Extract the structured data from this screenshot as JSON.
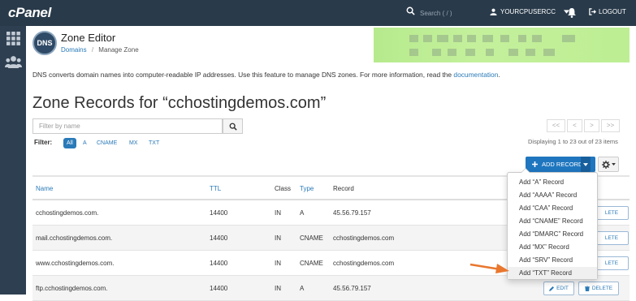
{
  "app": {
    "logo": "cPanel"
  },
  "header": {
    "search_placeholder": "Search ( / )",
    "username": "YOURCPUSERCC",
    "logout": "LOGOUT"
  },
  "page": {
    "title": "Zone Editor",
    "breadcrumb": {
      "root": "Domains",
      "separator": "/",
      "current": "Manage Zone"
    },
    "intro_text": "DNS converts domain names into computer-readable IP addresses. Use this feature to manage DNS zones. For more information, read the ",
    "intro_link": "documentation",
    "intro_end": ".",
    "badge": "DNS"
  },
  "zone": {
    "heading": "Zone Records for “cchostingdemos.com”",
    "filter_placeholder": "Filter by name",
    "filter_label": "Filter:",
    "filters": [
      "All",
      "A",
      "CNAME",
      "MX",
      "TXT"
    ],
    "active_filter": "All",
    "pager": [
      "<<",
      "<",
      ">",
      ">>"
    ],
    "displaying": "Displaying 1 to 23 out of 23 items",
    "add_record": "ADD RECORD"
  },
  "table": {
    "headers": {
      "name": "Name",
      "ttl": "TTL",
      "class": "Class",
      "type": "Type",
      "record": "Record"
    },
    "rows": [
      {
        "name": "cchostingdemos.com.",
        "ttl": "14400",
        "class": "IN",
        "type": "A",
        "record": "45.56.79.157"
      },
      {
        "name": "mail.cchostingdemos.com.",
        "ttl": "14400",
        "class": "IN",
        "type": "CNAME",
        "record": "cchostingdemos.com"
      },
      {
        "name": "www.cchostingdemos.com.",
        "ttl": "14400",
        "class": "IN",
        "type": "CNAME",
        "record": "cchostingdemos.com"
      },
      {
        "name": "ftp.cchostingdemos.com.",
        "ttl": "14400",
        "class": "IN",
        "type": "A",
        "record": "45.56.79.157"
      }
    ],
    "edit_label": "EDIT",
    "delete_label": "DELETE",
    "partial_delete": "LETE"
  },
  "dropdown": {
    "items": [
      "Add “A” Record",
      "Add “AAAA” Record",
      "Add “CAA” Record",
      "Add “CNAME” Record",
      "Add “DMARC” Record",
      "Add “MX” Record",
      "Add “SRV” Record",
      "Add “TXT” Record"
    ]
  },
  "colors": {
    "topbar": "#293a4a",
    "sidebar": "#2e3f51",
    "primary": "#1f76bf",
    "link": "#2a7ab8",
    "arrow": "#e9772e"
  }
}
